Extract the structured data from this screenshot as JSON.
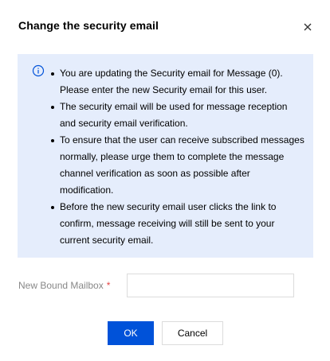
{
  "dialog": {
    "title": "Change the security email",
    "close_icon": "close-icon"
  },
  "notice": {
    "icon": "info-circle-icon",
    "items": [
      "You are updating the Security email for Message (0). Please enter the new Security email for this user.",
      "The security email will be used for message reception and security email verification.",
      "To ensure that the user can receive subscribed messages normally, please urge them to complete the message channel verification as soon as possible after modification.",
      "Before the new security email user clicks the link to confirm, message receiving will still be sent to your current security email."
    ]
  },
  "form": {
    "mailbox_label": "New Bound Mailbox",
    "required_mark": "*",
    "mailbox_value": "",
    "mailbox_placeholder": ""
  },
  "buttons": {
    "ok": "OK",
    "cancel": "Cancel"
  },
  "colors": {
    "primary": "#0052d9",
    "notice_bg": "#e5edfc",
    "required": "#e54545"
  }
}
